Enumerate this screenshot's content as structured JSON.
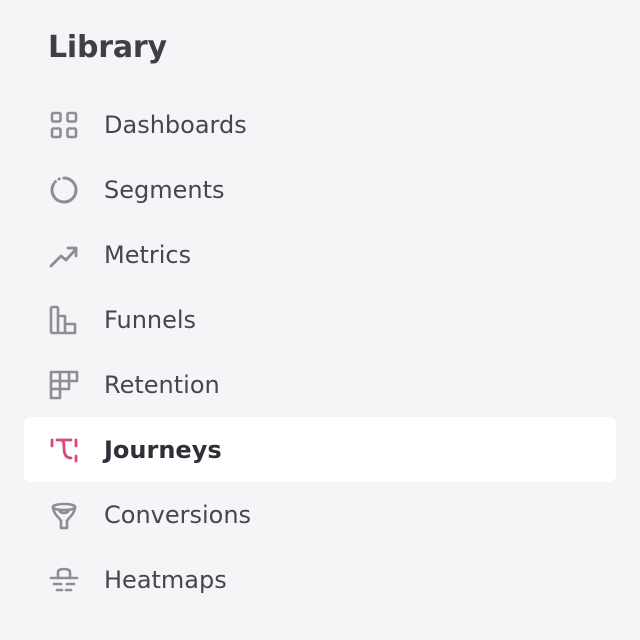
{
  "library": {
    "title": "Library",
    "items": [
      {
        "label": "Dashboards",
        "icon": "grid-icon",
        "active": false
      },
      {
        "label": "Segments",
        "icon": "dotted-ring-icon",
        "active": false
      },
      {
        "label": "Metrics",
        "icon": "trend-up-icon",
        "active": false
      },
      {
        "label": "Funnels",
        "icon": "funnel-bars-icon",
        "active": false
      },
      {
        "label": "Retention",
        "icon": "retention-grid-icon",
        "active": false
      },
      {
        "label": "Journeys",
        "icon": "journey-path-icon",
        "active": true
      },
      {
        "label": "Conversions",
        "icon": "conversion-funnel-icon",
        "active": false
      },
      {
        "label": "Heatmaps",
        "icon": "heatmap-icon",
        "active": false
      }
    ]
  },
  "colors": {
    "background": "#f5f5f7",
    "active_background": "#ffffff",
    "icon": "#8d8d94",
    "active_icon": "#d64a7f",
    "text": "#46464f"
  }
}
